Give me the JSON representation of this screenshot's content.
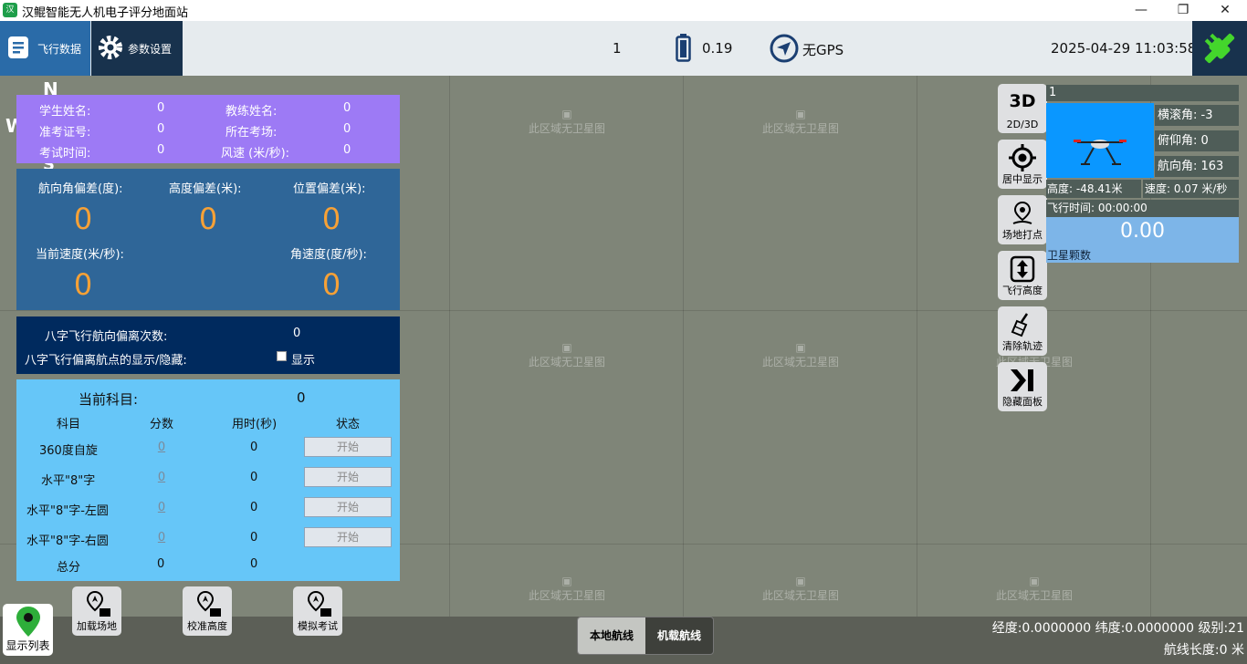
{
  "window": {
    "title": "汉鲲智能无人机电子评分地面站",
    "minimize": "—",
    "maximize": "❐",
    "close": "✕"
  },
  "topbar": {
    "tab_flight": "飞行数据",
    "tab_params": "参数设置",
    "count": "1",
    "battery": "0.19",
    "gps": "无GPS",
    "datetime": "2025-04-29 11:03:58"
  },
  "map": {
    "placeholder": "此区域无卫星图",
    "compass_n": "N",
    "compass_w": "W",
    "compass_s": "S"
  },
  "student": {
    "name_label": "学生姓名:",
    "name": "0",
    "coach_label": "教练姓名:",
    "coach": "0",
    "cert_label": "准考证号:",
    "cert": "0",
    "site_label": "所在考场:",
    "site": "0",
    "time_label": "考试时间:",
    "time": "0",
    "wind_label": "风速 (米/秒):",
    "wind": "0"
  },
  "deviation": {
    "heading_label": "航向角偏差(度):",
    "heading": "0",
    "height_label": "高度偏差(米):",
    "height": "0",
    "position_label": "位置偏差(米):",
    "position": "0",
    "speed_label": "当前速度(米/秒):",
    "speed": "0",
    "angular_label": "角速度(度/秒):",
    "angular": "0"
  },
  "eight": {
    "count_label": "八字飞行航向偏离次数:",
    "count": "0",
    "toggle_label": "八字飞行偏离航点的显示/隐藏:",
    "checkbox_label": "显示"
  },
  "exam": {
    "current_label": "当前科目:",
    "current": "0",
    "headers": [
      "科目",
      "分数",
      "用时(秒)",
      "状态"
    ],
    "rows": [
      {
        "name": "360度自旋",
        "score": "0",
        "time": "0",
        "action": "开始"
      },
      {
        "name": "水平\"8\"字",
        "score": "0",
        "time": "0",
        "action": "开始"
      },
      {
        "name": "水平\"8\"字-左圆",
        "score": "0",
        "time": "0",
        "action": "开始"
      },
      {
        "name": "水平\"8\"字-右圆",
        "score": "0",
        "time": "0",
        "action": "开始"
      }
    ],
    "total_label": "总分",
    "total_score": "0",
    "total_time": "0"
  },
  "tools": {
    "view": "2D/3D",
    "view_icon": "3D",
    "center": "居中显示",
    "mark": "场地打点",
    "altitude": "飞行高度",
    "clear": "清除轨迹",
    "hide": "隐藏面板"
  },
  "info": {
    "id": "1",
    "roll": "横滚角: -3",
    "pitch": "俯仰角: 0",
    "yaw": "航向角: 163",
    "height": "高度: -48.41米",
    "speed": "速度: 0.07 米/秒",
    "flight_time": "飞行时间: 00:00:00",
    "sat_value": "0.00",
    "sat_label": "卫星颗数"
  },
  "bottom": {
    "load_site": "加载场地",
    "calibrate": "校准高度",
    "simulate": "模拟考试",
    "show_list": "显示列表",
    "local_route": "本地航线",
    "onboard_route": "机载航线",
    "coords": "经度:0.0000000 纬度:0.0000000 级别:21",
    "route_length": "航线长度:0 米"
  },
  "colors": {
    "accent": "#f7a136",
    "active_tab": "#2a6ba8",
    "connect": "#44d62c"
  }
}
